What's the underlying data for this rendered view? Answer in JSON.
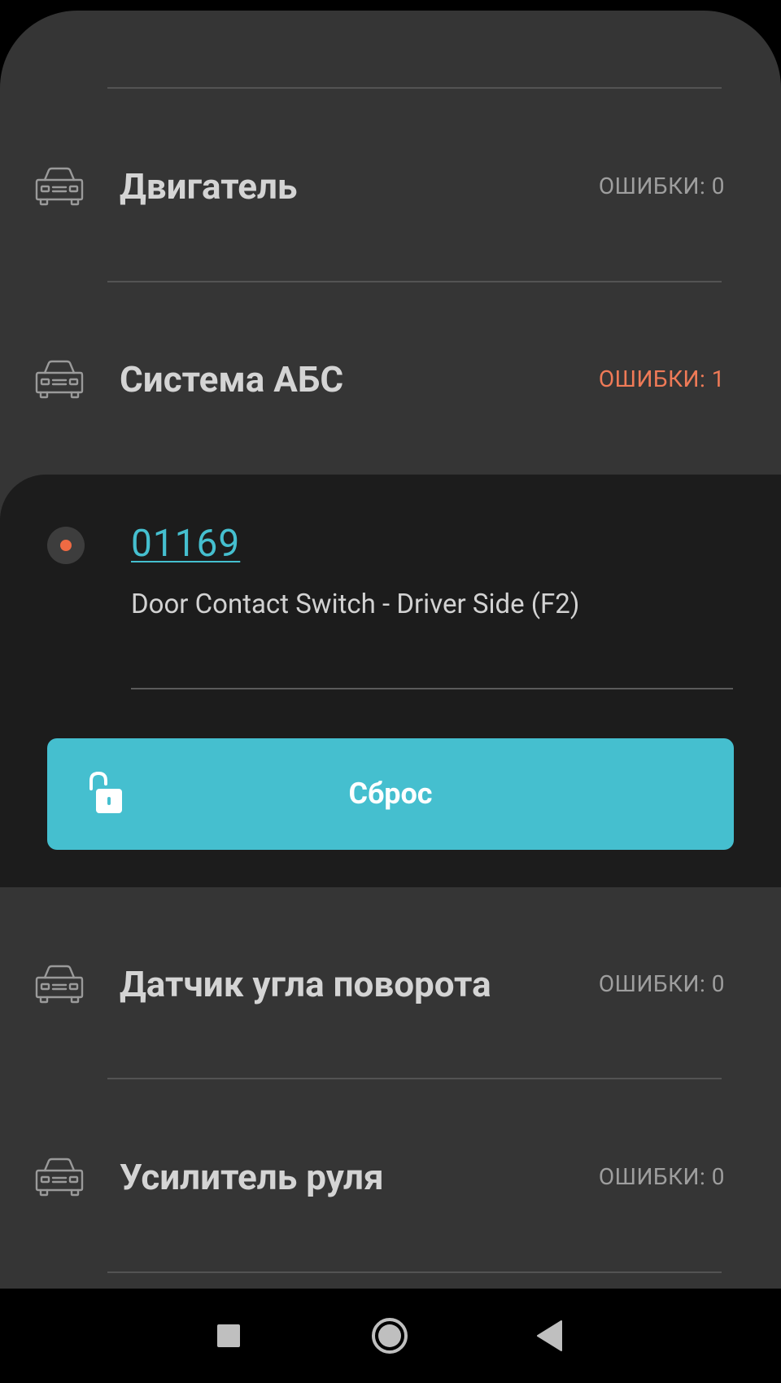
{
  "colors": {
    "background": "#353535",
    "panel": "#1c1c1c",
    "accent": "#45bfcf",
    "error": "#ef7a57",
    "muted_text": "#9e9e9e",
    "title_text": "#d4d4d4"
  },
  "icons": {
    "row_icon": "car-icon",
    "fault_indicator": "status-dot-icon",
    "reset_icon": "unlock-icon",
    "nav": [
      "square-recents-icon",
      "circle-home-icon",
      "triangle-back-icon"
    ]
  },
  "modules": [
    {
      "title": "Двигатель",
      "errors": "ОШИБКИ: 0"
    },
    {
      "title": "Система АБС",
      "errors": "ОШИБКИ: 1"
    },
    {
      "title": "Датчик угла поворота",
      "errors": "ОШИБКИ: 0"
    },
    {
      "title": "Усилитель руля",
      "errors": "ОШИБКИ: 0"
    }
  ],
  "fault": {
    "code": "01169",
    "description": "Door Contact Switch - Driver Side (F2)",
    "reset_label": "Сброс"
  }
}
